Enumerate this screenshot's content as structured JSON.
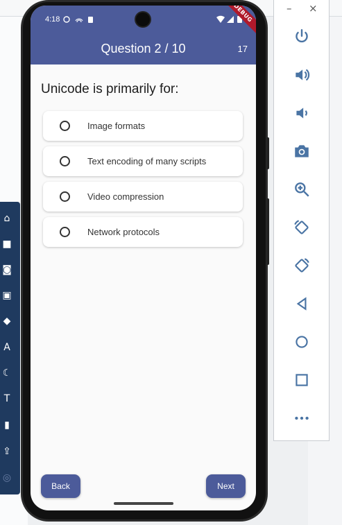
{
  "app": {
    "status_time": "4:18",
    "title": "Question 2 / 10",
    "counter": "17",
    "debug_banner": "DEBUG"
  },
  "question": {
    "text": "Unicode is primarily for:",
    "options": [
      "Image formats",
      "Text encoding of many scripts",
      "Video compression",
      "Network protocols"
    ]
  },
  "navigation": {
    "back_label": "Back",
    "next_label": "Next"
  },
  "emulator_panel": {
    "minimize_label": "–",
    "close_label": "×",
    "buttons": [
      "power-icon",
      "volume-up-icon",
      "volume-down-icon",
      "camera-icon",
      "zoom-in-icon",
      "rotate-left-icon",
      "rotate-right-icon",
      "back-icon",
      "home-icon",
      "overview-icon",
      "more-icon"
    ]
  },
  "colors": {
    "app_bar": "#4c5b9a",
    "button": "#4c5b9a",
    "debug": "#b0192b",
    "emulator_icon": "#4a74a4"
  }
}
